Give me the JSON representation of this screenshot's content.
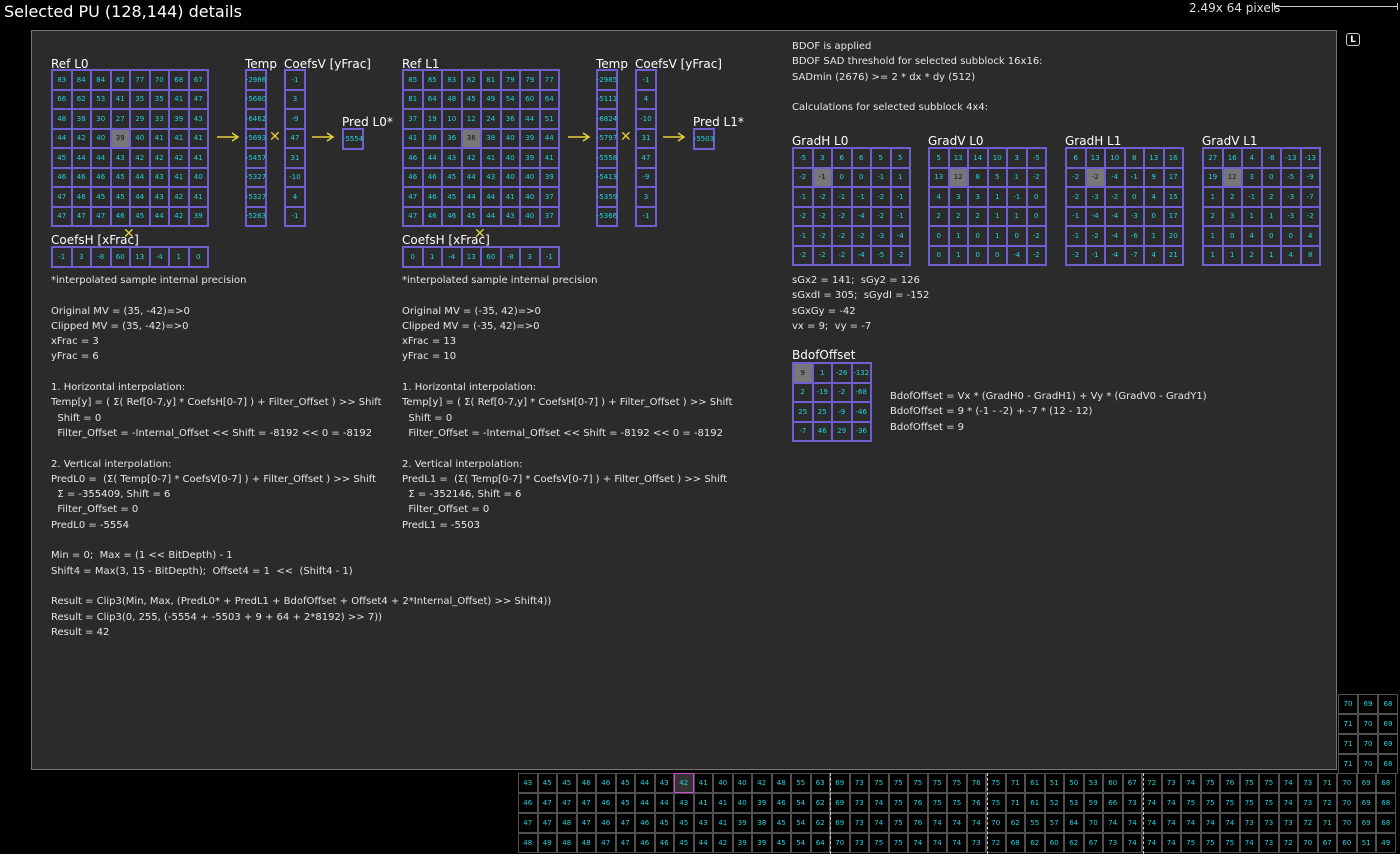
{
  "header": {
    "title": "Selected PU (128,144) details",
    "zoom_text": "2.49x  64 pixels",
    "l_button": "L"
  },
  "l0": {
    "ref_title": "Ref L0",
    "ref": [
      [
        83,
        84,
        84,
        82,
        77,
        70,
        68,
        67
      ],
      [
        66,
        62,
        53,
        41,
        35,
        35,
        41,
        47
      ],
      [
        48,
        38,
        30,
        27,
        29,
        33,
        39,
        43
      ],
      [
        44,
        42,
        40,
        39,
        40,
        41,
        41,
        41
      ],
      [
        45,
        44,
        44,
        43,
        42,
        42,
        42,
        41
      ],
      [
        46,
        46,
        46,
        45,
        44,
        43,
        41,
        40
      ],
      [
        47,
        46,
        45,
        45,
        44,
        43,
        42,
        41
      ],
      [
        47,
        47,
        47,
        46,
        45,
        44,
        42,
        39
      ]
    ],
    "temp_title": "Temp",
    "temp": [
      "-2986",
      "-5680",
      "-6462",
      "-5693",
      "-5457",
      "-5327",
      "-5327",
      "-5263"
    ],
    "coefsv_title": "CoefsV [yFrac]",
    "coefsv": [
      "-1",
      "3",
      "-9",
      "47",
      "31",
      "-10",
      "4",
      "-1"
    ],
    "pred_title": "Pred L0*",
    "pred": "-5554",
    "coefsh_title": "CoefsH [xFrac]",
    "coefsh": [
      "-1",
      "3",
      "-8",
      "60",
      "13",
      "-4",
      "1",
      "0"
    ],
    "text": "*interpolated sample internal precision\n\nOriginal MV = (35, -42)=>0\nClipped MV = (35, -42)=>0\nxFrac = 3\nyFrac = 6\n\n1. Horizontal interpolation:\nTemp[y] = ( Σ( Ref[0-7,y] * CoefsH[0-7] ) + Filter_Offset ) >> Shift\n  Shift = 0\n  Filter_Offset = -Internal_Offset << Shift = -8192 << 0 = -8192\n\n2. Vertical interpolation:\nPredL0 =  (Σ( Temp[0-7] * CoefsV[0-7] ) + Filter_Offset ) >> Shift\n  Σ = -355409, Shift = 6\n  Filter_Offset = 0\nPredL0 = -5554\n\nMin = 0;  Max = (1 << BitDepth) - 1\nShift4 = Max(3, 15 - BitDepth);  Offset4 = 1  <<  (Shift4 - 1)\n\nResult = Clip3(Min, Max, (PredL0* + PredL1 + BdofOffset + Offset4 + 2*Internal_Offset) >> Shift4))\nResult = Clip3(0, 255, (-5554 + -5503 + 9 + 64 + 2*8192) >> 7))\nResult = 42"
  },
  "l1": {
    "ref_title": "Ref L1",
    "ref": [
      [
        85,
        85,
        83,
        82,
        81,
        79,
        79,
        77
      ],
      [
        81,
        64,
        48,
        45,
        49,
        54,
        60,
        64
      ],
      [
        37,
        19,
        10,
        12,
        24,
        36,
        44,
        51
      ],
      [
        41,
        38,
        36,
        36,
        38,
        40,
        39,
        44
      ],
      [
        46,
        44,
        43,
        42,
        41,
        40,
        39,
        41
      ],
      [
        46,
        46,
        45,
        44,
        43,
        40,
        40,
        39
      ],
      [
        47,
        46,
        45,
        44,
        44,
        41,
        40,
        37
      ],
      [
        47,
        46,
        46,
        45,
        44,
        43,
        40,
        37
      ]
    ],
    "temp_title": "Temp",
    "temp": [
      "-2985",
      "-5111",
      "-6824",
      "-5797",
      "-5558",
      "-5413",
      "-5359",
      "-5366"
    ],
    "coefsv_title": "CoefsV [yFrac]",
    "coefsv": [
      "-1",
      "4",
      "-10",
      "31",
      "47",
      "-9",
      "3",
      "-1"
    ],
    "pred_title": "Pred L1*",
    "pred": "-5503",
    "coefsh_title": "CoefsH [xFrac]",
    "coefsh": [
      "0",
      "1",
      "-4",
      "13",
      "60",
      "-8",
      "3",
      "-1"
    ],
    "text": "*interpolated sample internal precision\n\nOriginal MV = (-35, 42)=>0\nClipped MV = (-35, 42)=>0\nxFrac = 13\nyFrac = 10\n\n1. Horizontal interpolation:\nTemp[y] = ( Σ( Ref[0-7,y] * CoefsH[0-7] ) + Filter_Offset ) >> Shift\n  Shift = 0\n  Filter_Offset = -Internal_Offset << Shift = -8192 << 0 = -8192\n\n2. Vertical interpolation:\nPredL1 =  (Σ( Temp[0-7] * CoefsV[0-7] ) + Filter_Offset ) >> Shift\n  Σ = -352146, Shift = 6\n  Filter_Offset = 0\nPredL1 = -5503"
  },
  "bdof": {
    "info": "BDOF is applied\nBDOF SAD threshold for selected subblock 16x16:\nSADmin (2676) >= 2 * dx * dy (512)\n\nCalculations for selected subblock 4x4:",
    "gradh_l0_title": "GradH L0",
    "gradh_l0": [
      [
        -5,
        3,
        6,
        6,
        5,
        5
      ],
      [
        -2,
        -1,
        0,
        0,
        -1,
        1
      ],
      [
        -1,
        -2,
        -1,
        -1,
        -2,
        -1
      ],
      [
        -2,
        -2,
        -2,
        -4,
        -2,
        -1
      ],
      [
        -1,
        -2,
        -2,
        -2,
        -3,
        -4
      ],
      [
        -2,
        -2,
        -2,
        -4,
        -5,
        -2
      ]
    ],
    "gradv_l0_title": "GradV L0",
    "gradv_l0": [
      [
        5,
        13,
        14,
        10,
        3,
        -5
      ],
      [
        13,
        12,
        8,
        5,
        1,
        -2
      ],
      [
        4,
        3,
        3,
        1,
        -1,
        0
      ],
      [
        2,
        2,
        2,
        1,
        1,
        0
      ],
      [
        0,
        1,
        0,
        1,
        0,
        -2
      ],
      [
        0,
        1,
        0,
        0,
        -4,
        -2
      ]
    ],
    "gradh_l1_title": "GradH L1",
    "gradh_l1": [
      [
        6,
        13,
        10,
        8,
        13,
        16
      ],
      [
        -2,
        -2,
        -4,
        -1,
        9,
        17
      ],
      [
        -2,
        -3,
        -2,
        0,
        4,
        15
      ],
      [
        -1,
        -4,
        -4,
        -3,
        0,
        17
      ],
      [
        -1,
        -2,
        -4,
        -6,
        1,
        20
      ],
      [
        -2,
        -1,
        -4,
        -7,
        4,
        21
      ]
    ],
    "gradv_l1_title": "GradV L1",
    "gradv_l1": [
      [
        27,
        16,
        4,
        -8,
        -13,
        -13
      ],
      [
        19,
        12,
        3,
        0,
        -5,
        -9
      ],
      [
        1,
        2,
        -1,
        2,
        -3,
        -7
      ],
      [
        2,
        3,
        1,
        1,
        -3,
        -2
      ],
      [
        1,
        0,
        4,
        0,
        0,
        4
      ],
      [
        1,
        1,
        2,
        1,
        4,
        8
      ]
    ],
    "sums": "sGx2 = 141;  sGy2 = 126\nsGxdI = 305;  sGydI = -152\nsGxGy = -42\nvx = 9;  vy = -7",
    "offset_title": "BdofOffset",
    "offset": [
      [
        9,
        1,
        -26,
        -132
      ],
      [
        2,
        -19,
        -2,
        -68
      ],
      [
        25,
        25,
        -9,
        -46
      ],
      [
        -7,
        46,
        29,
        -36
      ]
    ],
    "formula": "BdofOffset = Vx * (GradH0 - GradH1) + Vy * (GradV0 - GradY1)\nBdofOffset = 9 * (-1 - -2) + -7 * (12 - 12)\nBdofOffset = 9"
  },
  "bg": {
    "right": [
      [
        70,
        69,
        68
      ],
      [
        71,
        70,
        69
      ],
      [
        71,
        70,
        69
      ],
      [
        71,
        70,
        68
      ]
    ],
    "bottom": [
      [
        43,
        45,
        45,
        46,
        46,
        45,
        44,
        43,
        42,
        41,
        40,
        40,
        42,
        48,
        55,
        63,
        69,
        73,
        75,
        75,
        75,
        75,
        75,
        76,
        75,
        71,
        61,
        51,
        50,
        53,
        60,
        67,
        72,
        73,
        74,
        75,
        76,
        75,
        75,
        74,
        73,
        71,
        70,
        69,
        68
      ],
      [
        46,
        47,
        47,
        47,
        46,
        45,
        44,
        44,
        43,
        41,
        41,
        40,
        39,
        46,
        54,
        62,
        69,
        73,
        74,
        75,
        76,
        75,
        75,
        76,
        75,
        71,
        61,
        52,
        53,
        59,
        66,
        73,
        74,
        74,
        75,
        75,
        75,
        75,
        75,
        74,
        73,
        72,
        70,
        69,
        68
      ],
      [
        47,
        47,
        48,
        47,
        46,
        47,
        46,
        45,
        45,
        43,
        41,
        39,
        38,
        45,
        54,
        62,
        69,
        73,
        74,
        75,
        76,
        74,
        74,
        74,
        70,
        62,
        55,
        57,
        64,
        70,
        74,
        74,
        74,
        74,
        74,
        74,
        74,
        73,
        73,
        73,
        72,
        71,
        70,
        69,
        68
      ],
      [
        48,
        49,
        48,
        48,
        47,
        47,
        46,
        46,
        45,
        44,
        42,
        39,
        39,
        45,
        54,
        64,
        70,
        73,
        75,
        75,
        74,
        74,
        74,
        73,
        72,
        68,
        62,
        60,
        62,
        67,
        73,
        74,
        74,
        74,
        75,
        75,
        75,
        74,
        73,
        72,
        70,
        67,
        60,
        51,
        49
      ]
    ]
  }
}
